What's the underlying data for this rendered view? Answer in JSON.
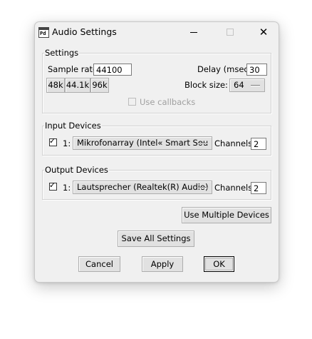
{
  "window": {
    "title": "Audio Settings",
    "icon_text": "Pd"
  },
  "settings": {
    "legend": "Settings",
    "sample_rate_label": "Sample rate:",
    "sample_rate_value": "44100",
    "delay_label": "Delay (msec):",
    "delay_value": "30",
    "rate_buttons": [
      "48k",
      "44.1k",
      "96k"
    ],
    "block_size_label": "Block size:",
    "block_size_value": "64",
    "use_callbacks_label": "Use callbacks",
    "use_callbacks_checked": false
  },
  "input_devices": {
    "legend": "Input Devices",
    "enabled": true,
    "index": "1:",
    "device": "Mikrofonarray (Intel« Smart Sou",
    "channels_label": "Channels:",
    "channels_value": "2"
  },
  "output_devices": {
    "legend": "Output Devices",
    "enabled": true,
    "index": "1:",
    "device": "Lautsprecher (Realtek(R) Audio)",
    "channels_label": "Channels:",
    "channels_value": "2"
  },
  "buttons": {
    "use_multiple_devices": "Use Multiple Devices",
    "save_all_settings": "Save All Settings",
    "cancel": "Cancel",
    "apply": "Apply",
    "ok": "OK"
  },
  "titlebar": {
    "minimize_icon": "minimize-icon",
    "maximize_icon": "maximize-icon",
    "close_icon": "close-icon",
    "close_glyph": "✕"
  }
}
